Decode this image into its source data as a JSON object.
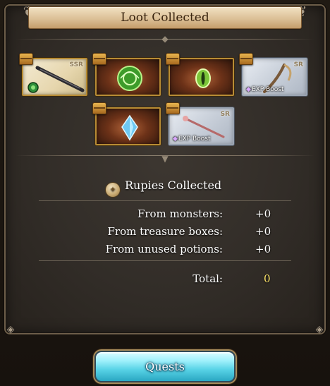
{
  "dialog": {
    "title": "Loot Collected"
  },
  "loot": {
    "items": [
      {
        "kind": "weapon",
        "rarity": "SSR",
        "tag": "",
        "background": "light"
      },
      {
        "kind": "summon",
        "rarity": "",
        "tag": "",
        "background": "dark"
      },
      {
        "kind": "summon",
        "rarity": "",
        "tag": "",
        "background": "dark"
      },
      {
        "kind": "weapon",
        "rarity": "SR",
        "tag": "EXP Boost",
        "background": "silver"
      },
      {
        "kind": "summon",
        "rarity": "",
        "tag": "",
        "background": "dark"
      },
      {
        "kind": "weapon",
        "rarity": "SR",
        "tag": "EXP Boost",
        "background": "silver"
      }
    ],
    "icons": {
      "chest": "treasure-chest-icon",
      "exp_gem": "exp-gem-icon"
    }
  },
  "rupies": {
    "title": "Rupies Collected",
    "rows": [
      {
        "label": "From monsters:",
        "value": "+0"
      },
      {
        "label": "From treasure boxes:",
        "value": "+0"
      },
      {
        "label": "From unused potions:",
        "value": "+0"
      }
    ],
    "total_label": "Total:",
    "total_value": "0",
    "colors": {
      "text": "#ffffff",
      "total_value": "#ffe66b"
    }
  },
  "actions": {
    "quests_label": "Quests"
  },
  "colors": {
    "panel": "#322d28",
    "header": "#dcc097",
    "button": "#58d3e6",
    "card_border": "#b88c34"
  }
}
